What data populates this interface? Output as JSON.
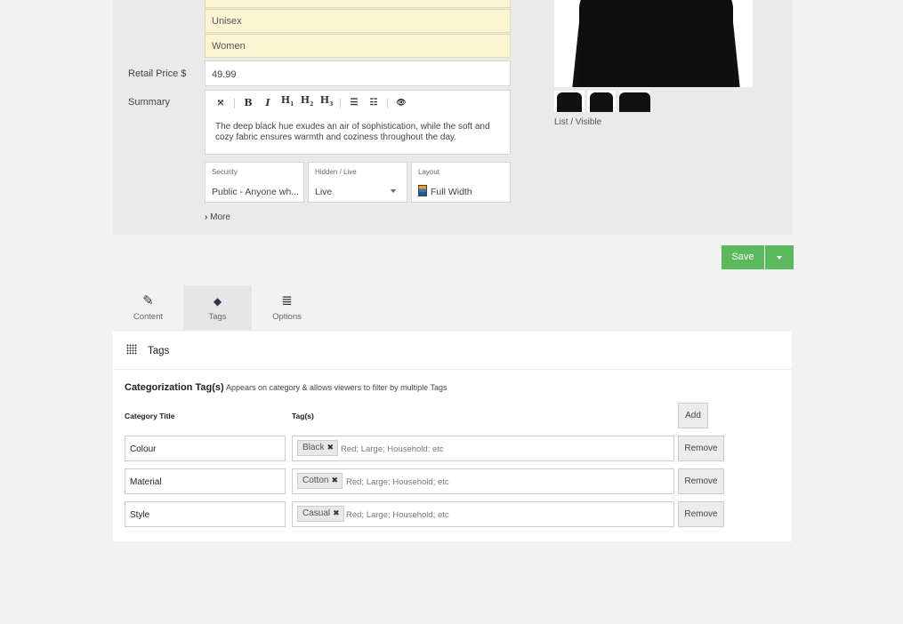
{
  "product_options": [
    "Unisex",
    "Women"
  ],
  "retail_price": {
    "label": "Retail Price $",
    "value": "49.99"
  },
  "summary": {
    "label": "Summary",
    "text": "The deep black hue exudes an air of sophistication, while the soft and cozy fabric ensures warmth and coziness throughout the day."
  },
  "toolbar": {
    "fullscreen": "⤧",
    "bold": "B",
    "italic": "I",
    "h1": "H",
    "h2": "H",
    "h3": "H",
    "h1_sub": "1",
    "h2_sub": "2",
    "h3_sub": "3",
    "bullet_list": "☰",
    "numbered_list": "☷",
    "preview": "👁"
  },
  "security": {
    "label": "Security",
    "value": "Public - Anyone wh..."
  },
  "visibility": {
    "label": "Hidden / Live",
    "value": "Live"
  },
  "layout": {
    "label": "Layout",
    "value": "Full Width"
  },
  "more_link": "More",
  "more_chevron": "›",
  "image_caption": "List / Visible",
  "save": {
    "label": "Save"
  },
  "tabs": [
    {
      "label": "Content",
      "icon": "✎"
    },
    {
      "label": "Tags",
      "icon": "◆"
    },
    {
      "label": "Options",
      "icon": "≣"
    }
  ],
  "tags_section": {
    "title": "Tags",
    "heading": "Categorization Tag(s)",
    "description": "Appears on category & allows viewers to filter by multiple Tags",
    "col_category": "Category Title",
    "col_tags": "Tag(s)",
    "add_label": "Add",
    "placeholder": "Red; Large; Household; etc",
    "remove_label": "Remove",
    "chip_remove": "✖",
    "rows": [
      {
        "category": "Colour",
        "tag": "Black"
      },
      {
        "category": "Material",
        "tag": "Cotton"
      },
      {
        "category": "Style",
        "tag": "Casual"
      }
    ]
  },
  "colors": {
    "accent_green": "#5cb85c",
    "option_bg": "#fbf5d4"
  }
}
